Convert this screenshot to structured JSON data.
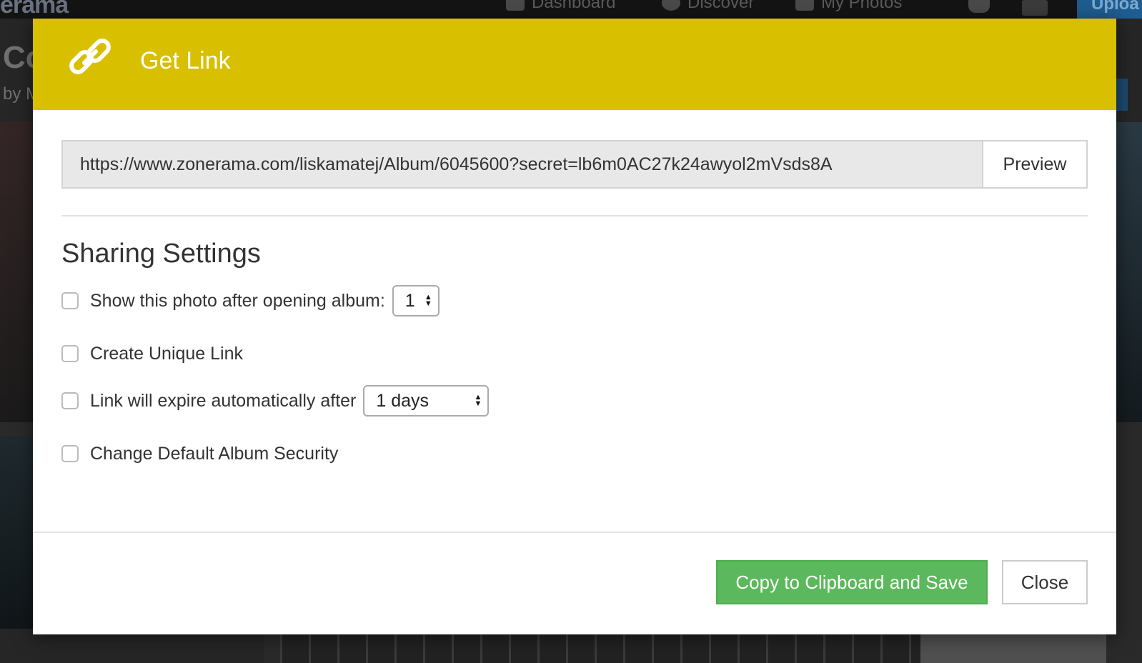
{
  "background": {
    "logo_fragment": "erama",
    "nav": [
      {
        "icon": "bar-chart-icon",
        "label": "Dashboard"
      },
      {
        "icon": "globe-icon",
        "label": "Discover"
      },
      {
        "icon": "photos-icon",
        "label": "My Photos"
      }
    ],
    "upload_label": "Uploa",
    "title_fragment": "Co",
    "by_fragment": "by M"
  },
  "dialog": {
    "icon": "link-icon",
    "title": "Get Link",
    "accent_color": "#d8bf00",
    "url": "https://www.zonerama.com/liskamatej/Album/6045600?secret=lb6m0AC27k24awyol2mVsds8A",
    "preview_label": "Preview",
    "sharing_title": "Sharing Settings",
    "options": {
      "show_photo_label": "Show this photo after opening album:",
      "show_photo_value": "1",
      "unique_link_label": "Create Unique Link",
      "expire_label": "Link will expire automatically after",
      "expire_value": "1 days",
      "security_label": "Change Default Album Security"
    },
    "copy_save_label": "Copy to Clipboard and Save",
    "close_label": "Close",
    "primary_color": "#5cb85c"
  }
}
